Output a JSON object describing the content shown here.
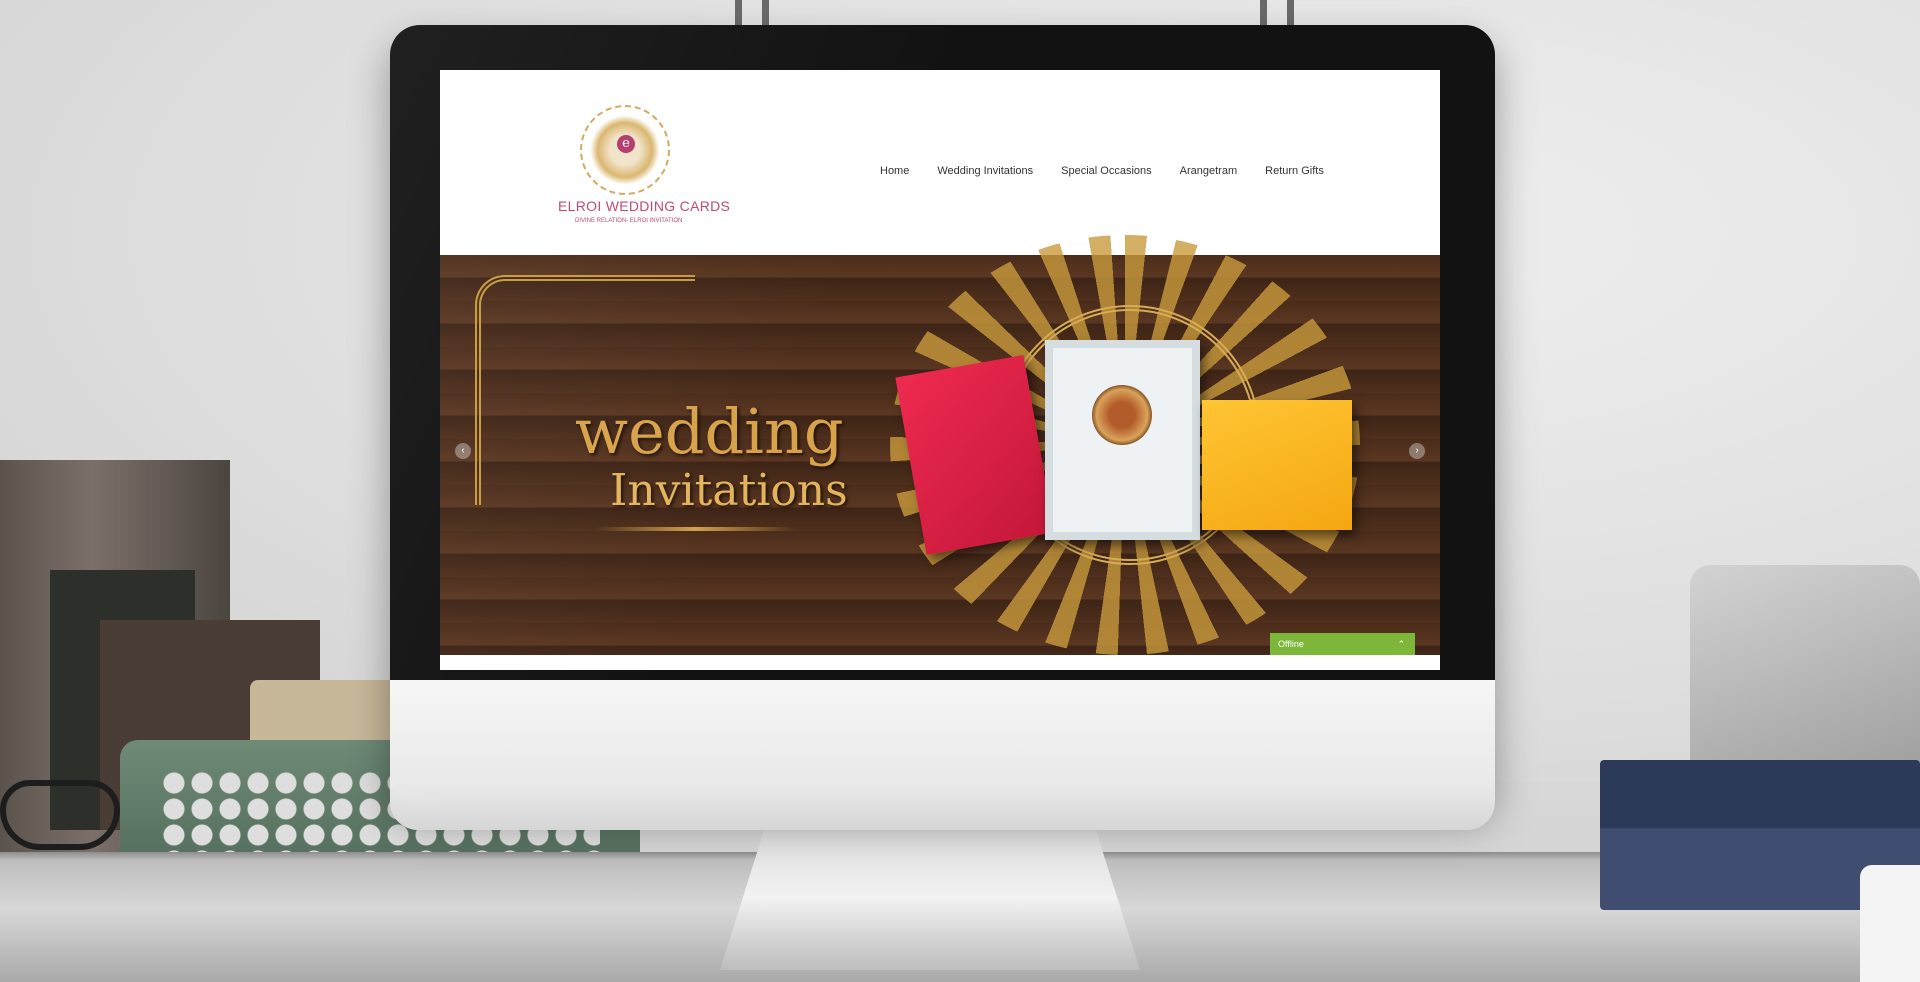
{
  "site": {
    "logo_name": "ELROI WEDDING CARDS",
    "logo_tagline": "DIVINE RELATION- ELROI INVITATION",
    "logo_letter": "e"
  },
  "nav": {
    "items": [
      {
        "label": "Home"
      },
      {
        "label": "Wedding Invitations"
      },
      {
        "label": "Special Occasions"
      },
      {
        "label": "Arangetram"
      },
      {
        "label": "Return Gifts"
      }
    ]
  },
  "banner": {
    "title": "wedding",
    "subtitle": "Invitations",
    "prev_icon": "chevron-left-icon",
    "next_icon": "chevron-right-icon"
  },
  "chat_widget": {
    "status": "Offline",
    "toggle_icon": "chevron-up-icon"
  },
  "colors": {
    "brand_pink": "#c04573",
    "gold": "#d8a24a",
    "wood": "#4a2c1a",
    "chat_green": "#7cb73a"
  }
}
